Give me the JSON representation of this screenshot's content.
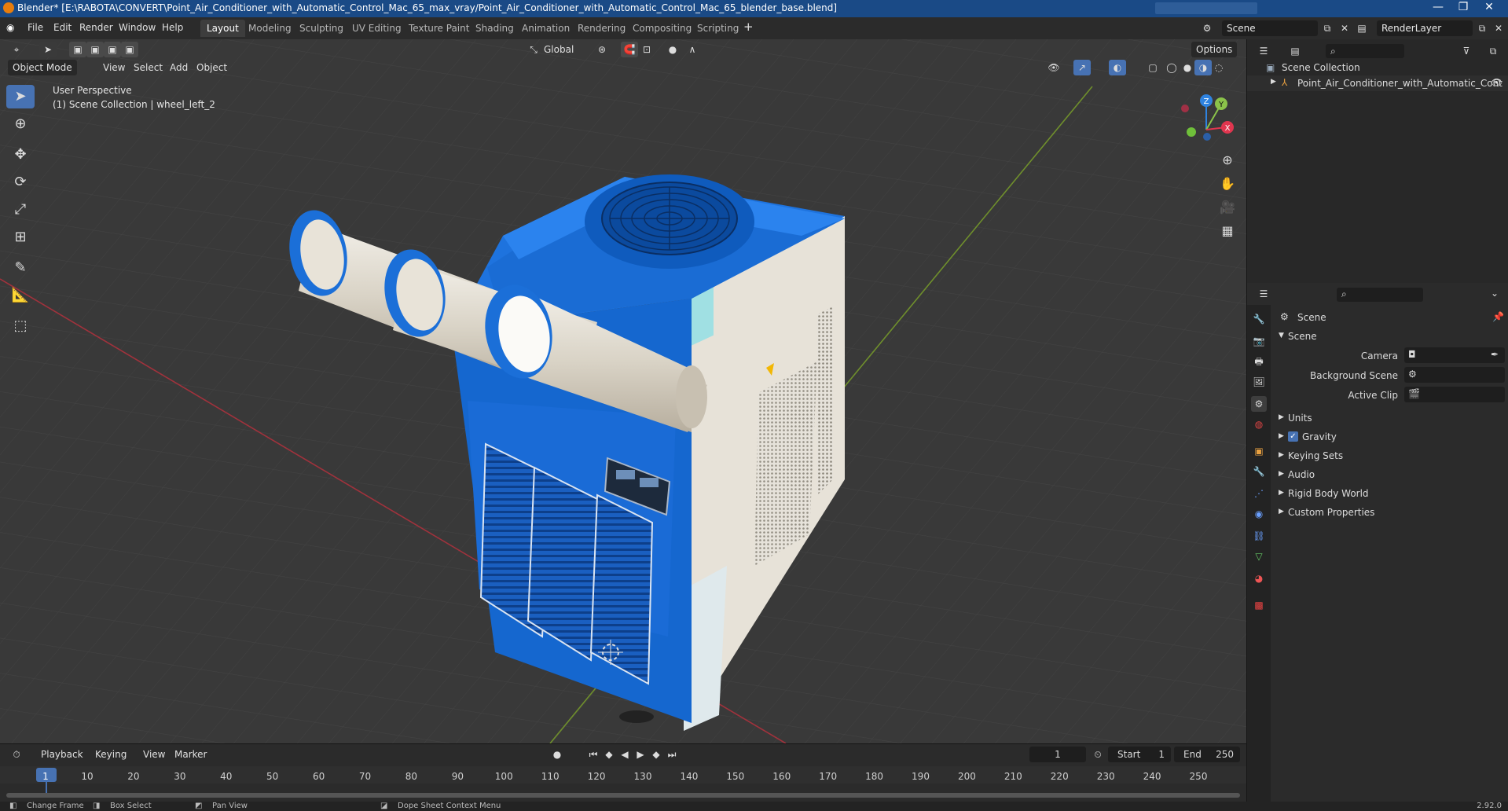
{
  "window": {
    "title": "Blender* [E:\\RABOTA\\CONVERT\\Point_Air_Conditioner_with_Automatic_Control_Mac_65_max_vray/Point_Air_Conditioner_with_Automatic_Control_Mac_65_blender_base.blend]",
    "controls": [
      "—",
      "❐",
      "✕"
    ]
  },
  "menubar": {
    "menus": [
      "File",
      "Edit",
      "Render",
      "Window",
      "Help"
    ],
    "workspaces": [
      "Layout",
      "Modeling",
      "Sculpting",
      "UV Editing",
      "Texture Paint",
      "Shading",
      "Animation",
      "Rendering",
      "Compositing",
      "Scripting"
    ],
    "active_workspace": "Layout",
    "scene_name": "Scene",
    "view_layer": "RenderLayer"
  },
  "viewport": {
    "mode": "Object Mode",
    "menus": [
      "View",
      "Select",
      "Add",
      "Object"
    ],
    "transform_orientation": "Global",
    "options_label": "Options",
    "overlay_line1": "User Perspective",
    "overlay_line2": "(1) Scene Collection | wheel_left_2",
    "gizmo_axes": {
      "x": "X",
      "y": "Y",
      "z": "Z"
    }
  },
  "outliner": {
    "root": "Scene Collection",
    "items": [
      {
        "label": "Point_Air_Conditioner_with_Automatic_Cont",
        "visible": true
      }
    ]
  },
  "properties": {
    "context": "Scene",
    "panel_title": "Scene",
    "fields": [
      {
        "label": "Camera",
        "value": ""
      },
      {
        "label": "Background Scene",
        "value": ""
      },
      {
        "label": "Active Clip",
        "value": ""
      }
    ],
    "subpanels": [
      "Units",
      "Gravity",
      "Keying Sets",
      "Audio",
      "Rigid Body World",
      "Custom Properties"
    ],
    "gravity_checked": true
  },
  "timeline": {
    "menus": [
      "Playback",
      "Keying",
      "View",
      "Marker"
    ],
    "current_frame": "1",
    "start_label": "Start",
    "start": "1",
    "end_label": "End",
    "end": "250",
    "ticks": [
      "1",
      "10",
      "20",
      "30",
      "40",
      "50",
      "60",
      "70",
      "80",
      "90",
      "100",
      "110",
      "120",
      "130",
      "140",
      "150",
      "160",
      "170",
      "180",
      "190",
      "200",
      "210",
      "220",
      "230",
      "240",
      "250"
    ]
  },
  "statusbar": {
    "items": [
      "Change Frame",
      "Box Select",
      "Pan View",
      "Dope Sheet Context Menu"
    ],
    "version": "2.92.0"
  },
  "colors": {
    "accent": "#4772b3",
    "unit_blue": "#1565c9",
    "unit_panel": "#e7e2d8",
    "x_axis": "#e0364f",
    "y_axis": "#8bc34a",
    "z_axis": "#2f83e0"
  }
}
